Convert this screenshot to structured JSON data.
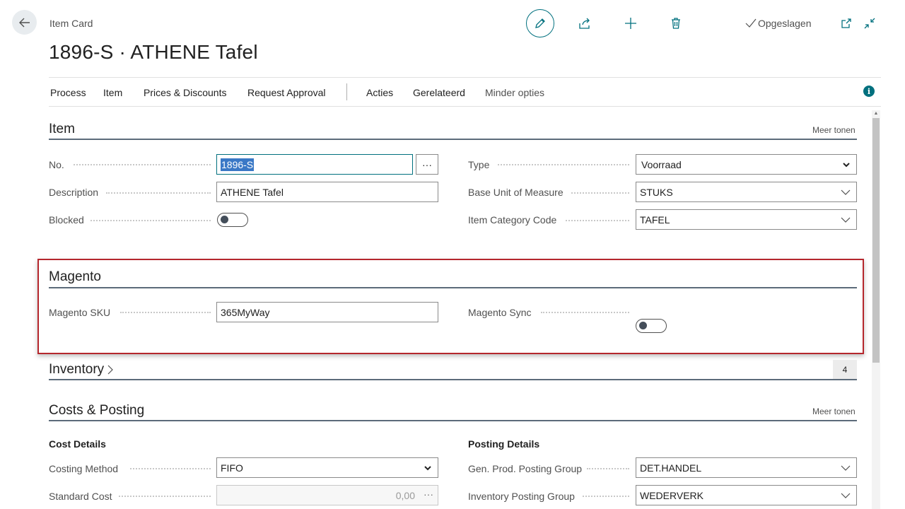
{
  "header": {
    "breadcrumb": "Item Card",
    "title": "1896-S · ATHENE Tafel",
    "saved_label": "Opgeslagen"
  },
  "actionbar": {
    "items": [
      "Process",
      "Item",
      "Prices & Discounts",
      "Request Approval",
      "Acties",
      "Gerelateerd",
      "Minder opties"
    ]
  },
  "item_section": {
    "title": "Item",
    "show_more": "Meer tonen",
    "fields": {
      "no_label": "No.",
      "no_value": "1896-S",
      "description_label": "Description",
      "description_value": "ATHENE Tafel",
      "blocked_label": "Blocked",
      "blocked_value": false,
      "type_label": "Type",
      "type_value": "Voorraad",
      "base_uom_label": "Base Unit of Measure",
      "base_uom_value": "STUKS",
      "category_label": "Item Category Code",
      "category_value": "TAFEL"
    }
  },
  "magento_section": {
    "title": "Magento",
    "sku_label": "Magento SKU",
    "sku_value": "365MyWay",
    "sync_label": "Magento Sync",
    "sync_value": false
  },
  "inventory_section": {
    "title": "Inventory",
    "badge": "4"
  },
  "costs_section": {
    "title": "Costs & Posting",
    "show_more": "Meer tonen",
    "cost_details": "Cost Details",
    "posting_details": "Posting Details",
    "costing_method_label": "Costing Method",
    "costing_method_value": "FIFO",
    "standard_cost_label": "Standard Cost",
    "standard_cost_value": "0,00",
    "gen_prod_label": "Gen. Prod. Posting Group",
    "gen_prod_value": "DET.HANDEL",
    "inv_posting_label": "Inventory Posting Group",
    "inv_posting_value": "WEDERVERK"
  },
  "colors": {
    "accent": "#00707e",
    "highlight_border": "#b5272d",
    "selection": "#3a78c6"
  }
}
